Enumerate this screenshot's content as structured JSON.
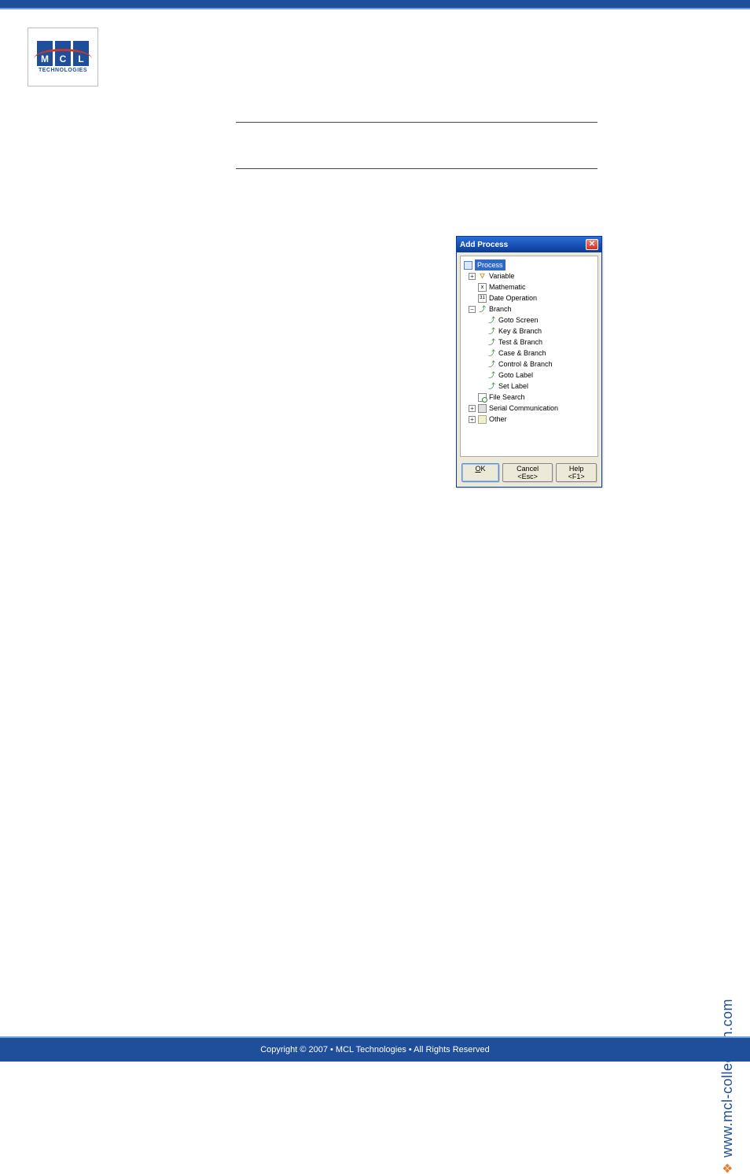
{
  "logo": {
    "letters": [
      "M",
      "C",
      "L"
    ],
    "sub": "TECHNOLOGIES"
  },
  "dialog": {
    "title": "Add Process",
    "close": "✕",
    "tree": {
      "root": "Process",
      "variable": "Variable",
      "mathematic": "Mathematic",
      "date_op": "Date Operation",
      "branch": "Branch",
      "branch_children": [
        "Goto Screen",
        "Key & Branch",
        "Test & Branch",
        "Case & Branch",
        "Control & Branch",
        "Goto Label",
        "Set Label"
      ],
      "file_search": "File Search",
      "serial": "Serial Communication",
      "other": "Other"
    },
    "buttons": {
      "ok": "OK",
      "cancel": "Cancel <Esc>",
      "help": "Help <F1>"
    }
  },
  "side_url": "www.mcl-collection.com",
  "footer": "Copyright © 2007 • MCL Technologies • All Rights Reserved"
}
